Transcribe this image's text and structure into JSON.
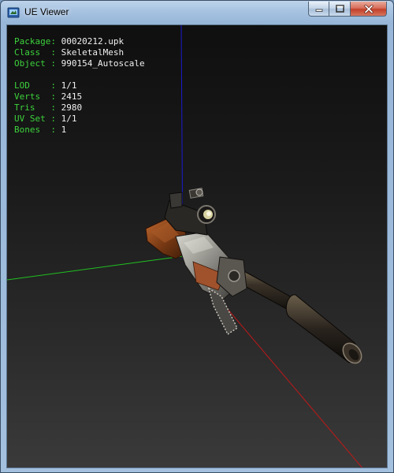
{
  "window": {
    "title": "UE Viewer"
  },
  "info": {
    "rows": [
      {
        "label": "Package",
        "value": "00020212.upk"
      },
      {
        "label": "Class  ",
        "value": "SkeletalMesh"
      },
      {
        "label": "Object ",
        "value": "990154_Autoscale"
      },
      {
        "label": "LOD    ",
        "value": "1/1"
      },
      {
        "label": "Verts  ",
        "value": "2415"
      },
      {
        "label": "Tris   ",
        "value": "2980"
      },
      {
        "label": "UV Set ",
        "value": "1/1"
      },
      {
        "label": "Bones  ",
        "value": "1"
      }
    ],
    "separator": ": "
  },
  "colors": {
    "label_green": "#3cd23c",
    "value_white": "#f0f0f0",
    "axis_x": "#c01818",
    "axis_y": "#20c020",
    "axis_z": "#1a1ad0",
    "close_red": "#c2402a"
  },
  "icons": {
    "app": "ue-viewer-app-icon",
    "minimize": "minimize-icon",
    "maximize": "maximize-icon",
    "close": "close-icon"
  },
  "model": {
    "description_visible": "3d-rifle-mesh"
  }
}
